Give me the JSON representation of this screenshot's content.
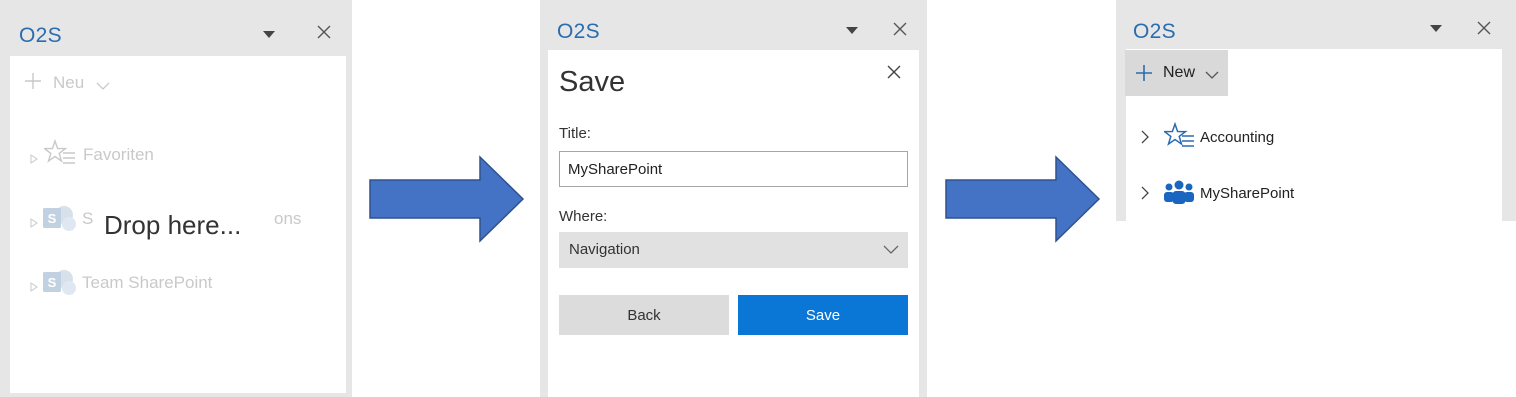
{
  "panel1": {
    "title": "O2S",
    "ghost_items": {
      "new_label": "Neu",
      "favorites": "Favoriten",
      "site_s": "S",
      "site_ons": "ons",
      "team": "Team SharePoint"
    },
    "drop_text": "Drop here..."
  },
  "panel2": {
    "title": "O2S",
    "dialog_title": "Save",
    "title_label": "Title:",
    "title_value": "MySharePoint",
    "where_label": "Where:",
    "where_value": "Navigation",
    "back_label": "Back",
    "save_label": "Save"
  },
  "panel3": {
    "title": "O2S",
    "new_label": "New",
    "items": [
      {
        "label": "Accounting",
        "icon": "favorites-star-list-icon"
      },
      {
        "label": "MySharePoint",
        "icon": "people-group-icon"
      }
    ]
  },
  "colors": {
    "accent": "#2b6cb0",
    "primary_button": "#0a77d6",
    "arrow": "#4472c4",
    "pane_background": "#e6e6e6"
  }
}
